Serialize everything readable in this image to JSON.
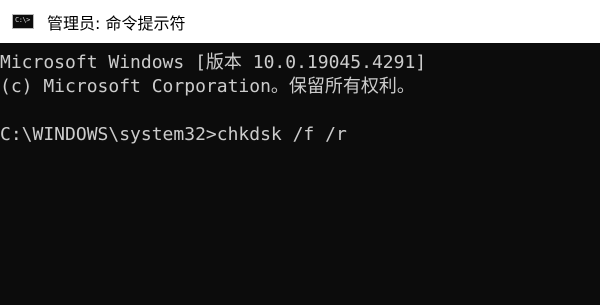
{
  "window": {
    "title": "管理员: 命令提示符",
    "icon_name": "cmd-icon",
    "icon_text": "C:\\>"
  },
  "console": {
    "lines": [
      "Microsoft Windows [版本 10.0.19045.4291]",
      "(c) Microsoft Corporation。保留所有权利。",
      "",
      "C:\\WINDOWS\\system32>chkdsk /f /r"
    ]
  },
  "colors": {
    "title_bar_bg": "#ffffff",
    "console_bg": "#0c0c0c",
    "console_text": "#cccccc"
  }
}
